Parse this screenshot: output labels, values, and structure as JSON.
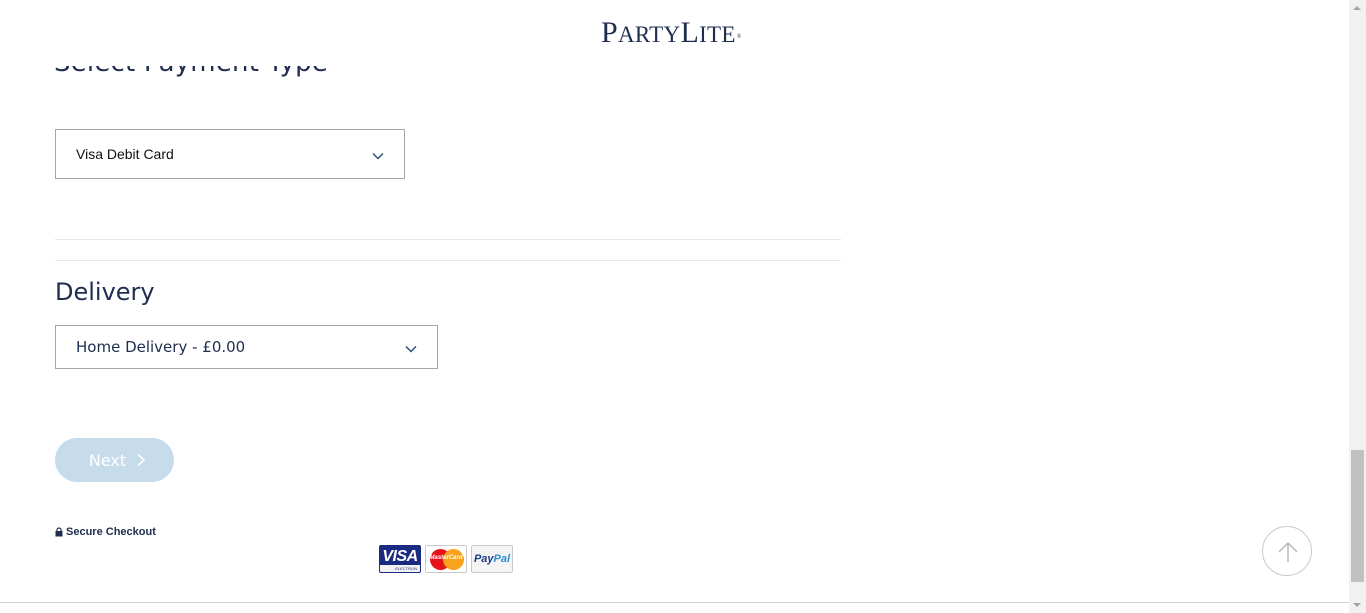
{
  "header": {
    "brand_lead": "P",
    "brand_rest1": "ARTY",
    "brand_l": "L",
    "brand_rest2": "ITE",
    "brand_mark": "®"
  },
  "payment": {
    "section_title": "Select Payment Type",
    "selected_value": "Visa Debit Card"
  },
  "delivery": {
    "title": "Delivery",
    "selected_value": "Home Delivery - £0.00"
  },
  "actions": {
    "next_label": "Next",
    "next_enabled": false
  },
  "footer": {
    "secure_label": "Secure Checkout",
    "payment_logos": [
      {
        "name": "visa-electron",
        "text": "VISA",
        "sub": "ELECTRON"
      },
      {
        "name": "mastercard",
        "text": "MasterCard"
      },
      {
        "name": "paypal",
        "text_a": "Pay",
        "text_b": "Pal"
      }
    ]
  },
  "colors": {
    "brand_navy": "#1f2d4f",
    "button_disabled": "#c6dcea",
    "border": "#a7a7a7"
  },
  "icons": [
    "chevron-down-icon",
    "chevron-right-icon",
    "lock-icon",
    "arrow-up-icon"
  ],
  "scroll": {
    "position_fraction": 0.86
  }
}
